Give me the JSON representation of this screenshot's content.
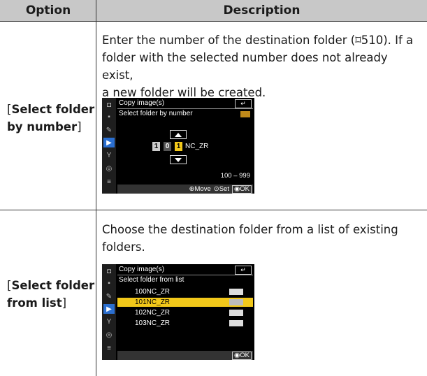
{
  "header": {
    "col_option": "Option",
    "col_description": "Description"
  },
  "rows": [
    {
      "option_open": "[",
      "option_bold_1": "Select folder",
      "option_bold_2": "by number",
      "option_close": "]",
      "desc_line1": "Enter the number of the destination folder (⌑510). If a",
      "desc_line2": "folder with the selected number does not already exist,",
      "desc_line3": "a new folder will be created.",
      "screen": {
        "title": "Copy image(s)",
        "subtitle": "Select folder by number",
        "digits": [
          "1",
          "0",
          "1"
        ],
        "suffix": "NC_ZR",
        "range": "100 – 999",
        "foot_move": "⊕Move",
        "foot_set": "⊙Set",
        "foot_ok": "◉OK",
        "back": "↵"
      }
    },
    {
      "option_open": "[",
      "option_bold_1": "Select folder",
      "option_bold_2": "from list",
      "option_close": "]",
      "desc_line1": "Choose the destination folder from a list of existing",
      "desc_line2": "folders.",
      "screen": {
        "title": "Copy image(s)",
        "subtitle": "Select folder from list",
        "folders": [
          "100NC_ZR",
          "101NC_ZR",
          "102NC_ZR",
          "103NC_ZR"
        ],
        "selected_index": 1,
        "foot_ok": "◉OK",
        "back": "↵"
      }
    }
  ],
  "colors": {
    "header_bg": "#c8c8c8",
    "highlight": "#f2c81a",
    "menu_selected": "#2b6fd0"
  }
}
